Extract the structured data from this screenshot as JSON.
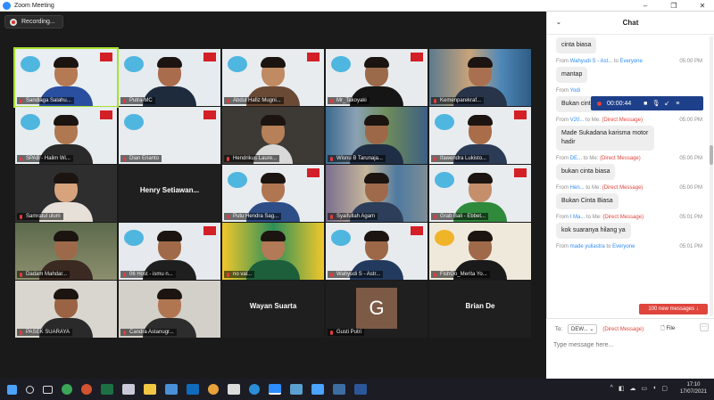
{
  "window": {
    "title": "Zoom Meeting",
    "minimize": "–",
    "maximize": "❐",
    "close": "✕"
  },
  "recording_label": "Recording...",
  "participants": [
    {
      "name": "Sandiaga Salahu..."
    },
    {
      "name": "Putra-MC"
    },
    {
      "name": "Abdul Hafiz Mugni..."
    },
    {
      "name": "Mr_Takoyaki"
    },
    {
      "name": "Kemenparekraf..."
    },
    {
      "name": "SPAB - Halim Wi..."
    },
    {
      "name": "Dian Erianto"
    },
    {
      "name": "Hendrikus Laure..."
    },
    {
      "name": "Wisnu B Tarunaja..."
    },
    {
      "name": "Ifawendra Lukisto..."
    },
    {
      "name": "Samratul ulum"
    },
    {
      "name": "Henry Setiawan..."
    },
    {
      "name": "Putu Hendra Sag..."
    },
    {
      "name": "Syaifullah Agam"
    },
    {
      "name": "Grab Bali - Ebbet..."
    },
    {
      "name": "Dadam Mahdar..."
    },
    {
      "name": "06 Host - ismu n..."
    },
    {
      "name": "no val..."
    },
    {
      "name": "Wahyudi S - Astr..."
    },
    {
      "name": "FishGo_Merita Yo..."
    },
    {
      "name": "PASEK SUARAYA"
    },
    {
      "name": "Candra Astanugr..."
    },
    {
      "name": "Wayan Suarta"
    },
    {
      "name": "Gusti Putri"
    },
    {
      "name": "Brian De"
    }
  ],
  "name_cards": {
    "henry": "Henry  Setiawan...",
    "wayan": "Wayan Suarta",
    "gusti_initial": "G",
    "brian": "Brian De"
  },
  "chat": {
    "title": "Chat",
    "collapse_icon": "chevron-down-icon",
    "messages": [
      {
        "from": "",
        "to": "",
        "direct": "",
        "time": "",
        "text": "cinta biasa"
      },
      {
        "from": "Wahyudi S - Ast...",
        "to": "Everyone",
        "direct": "",
        "time": "05:00 PM",
        "text": "mantap"
      },
      {
        "from": "Yodi",
        "to": "",
        "direct": "",
        "time": "",
        "text": "Bukan cinta biasa"
      },
      {
        "from": "V20...",
        "to": "Me:",
        "direct": "(Direct Message)",
        "time": "05:00 PM",
        "text": "Made Sukadana karisma motor hadir"
      },
      {
        "from": "DE...",
        "to": "Me:",
        "direct": "(Direct Message)",
        "time": "05:00 PM",
        "text": "bukan cinta biasa"
      },
      {
        "from": "Hen...",
        "to": "Me:",
        "direct": "(Direct Message)",
        "time": "05:00 PM",
        "text": "Bukan Cinta Biasa"
      },
      {
        "from": "I Ma...",
        "to": "Me:",
        "direct": "(Direct Message)",
        "time": "05:01 PM",
        "text": "kok suaranya hilang ya"
      },
      {
        "from": "made yuliastra",
        "to": "Everyone",
        "direct": "",
        "time": "05:01 PM",
        "text": ""
      }
    ],
    "from_word": "From",
    "to_word": "to",
    "new_messages": "100 new messages ↓",
    "to_label": "To:",
    "to_value": "DEW...",
    "to_direct": "(Direct Message)",
    "file_label": "File",
    "more_label": "···",
    "input_placeholder": "Type message here..."
  },
  "recording_bar": {
    "timer": "00:00:44"
  },
  "taskbar": {
    "time": "17:10",
    "date": "17/07/2021",
    "icons": [
      "windows-start-icon",
      "search-icon",
      "task-view-icon",
      "chrome-icon",
      "powerpoint-icon",
      "excel-icon",
      "paint-icon",
      "file-explorer-icon",
      "store-icon",
      "outlook-icon",
      "chrome-icon",
      "capture-icon",
      "edge-icon",
      "zoom-icon",
      "app-icon",
      "app-icon",
      "app-icon",
      "word-icon"
    ]
  }
}
